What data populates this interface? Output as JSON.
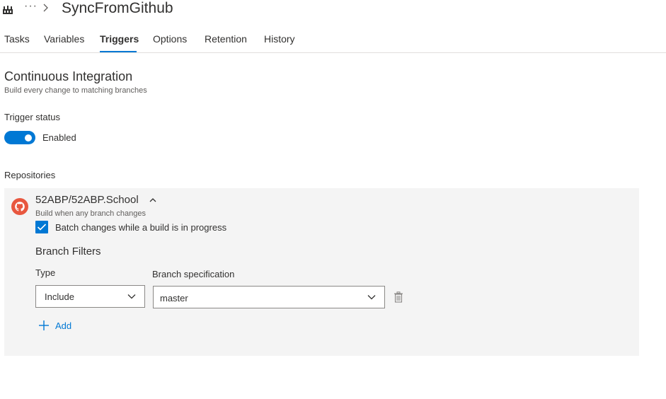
{
  "header": {
    "overflow_label": "···",
    "title": "SyncFromGithub",
    "icons": {
      "app": "build-pipeline-icon",
      "separator": "chevron-right-icon"
    }
  },
  "tabs": [
    {
      "label": "Tasks",
      "active": false
    },
    {
      "label": "Variables",
      "active": false
    },
    {
      "label": "Triggers",
      "active": true
    },
    {
      "label": "Options",
      "active": false
    },
    {
      "label": "Retention",
      "active": false
    },
    {
      "label": "History",
      "active": false
    }
  ],
  "ci": {
    "title": "Continuous Integration",
    "subtitle": "Build every change to matching branches",
    "trigger_status_label": "Trigger status",
    "toggle_label": "Enabled",
    "toggle_on": true
  },
  "repositories": {
    "label": "Repositories",
    "repo": {
      "name": "52ABP/52ABP.School",
      "subtitle": "Build when any branch changes",
      "icon": "github-icon",
      "batch_label": "Batch changes while a build is in progress",
      "batch_checked": true,
      "branch_filters": {
        "title": "Branch Filters",
        "type_label": "Type",
        "spec_label": "Branch specification",
        "type_value": "Include",
        "spec_value": "master"
      },
      "add_label": "Add"
    }
  },
  "colors": {
    "accent": "#0078d4",
    "panel_bg": "#f4f4f4",
    "text": "#323130",
    "github_red": "#e8573f"
  }
}
